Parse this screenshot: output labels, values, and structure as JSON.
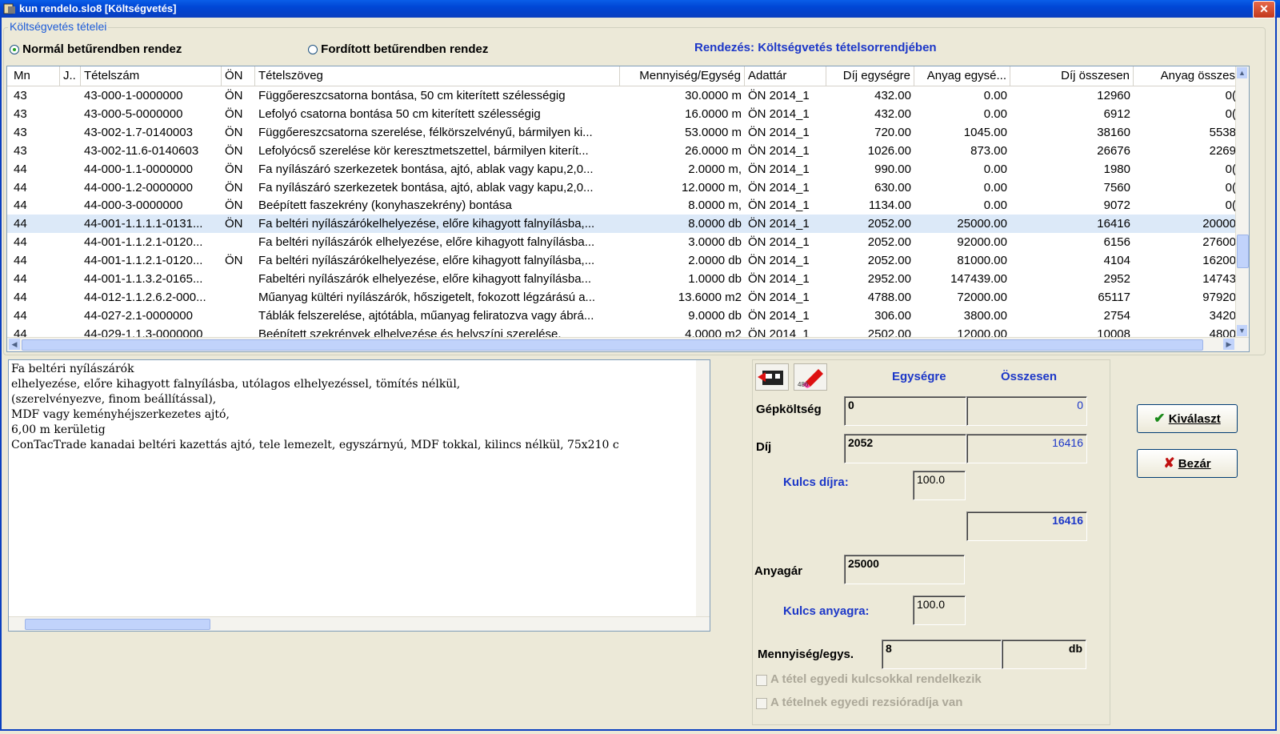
{
  "window": {
    "title": "kun rendelo.slo8 [Költségvetés]",
    "close": "✕"
  },
  "group_label": "Költségvetés tételei",
  "sort_options": [
    {
      "label": "Normál betűrendben rendez",
      "selected": true
    },
    {
      "label": "Fordított betűrendben rendez",
      "selected": false
    }
  ],
  "sort_status": "Rendezés: Költségvetés tételsorrendjében",
  "table": {
    "columns": [
      "Mn",
      "J..",
      "Tételszám",
      "ÖN",
      "Tételszöveg",
      "Mennyiség/Egység",
      "Adattár",
      "Díj egységre",
      "Anyag egysé...",
      "Díj összesen",
      "Anyag összes"
    ],
    "rows": [
      [
        "43",
        "",
        "43-000-1-0000000",
        "ÖN",
        "Függőereszcsatorna bontása, 50 cm kiterített szélességig",
        "30.0000 m",
        "ÖN 2014_1",
        "432.00",
        "0.00",
        "12960",
        "0("
      ],
      [
        "43",
        "",
        "43-000-5-0000000",
        "ÖN",
        "Lefolyó csatorna bontása 50 cm kiterített szélességig",
        "16.0000 m",
        "ÖN 2014_1",
        "432.00",
        "0.00",
        "6912",
        "0("
      ],
      [
        "43",
        "",
        "43-002-1.7-0140003",
        "ÖN",
        "Függőereszcsatorna szerelése, félkörszelvényű, bármilyen ki...",
        "53.0000 m",
        "ÖN 2014_1",
        "720.00",
        "1045.00",
        "38160",
        "5538"
      ],
      [
        "43",
        "",
        "43-002-11.6-0140603",
        "ÖN",
        "Lefolyócső szerelése kör keresztmetszettel, bármilyen kiterít...",
        "26.0000 m",
        "ÖN 2014_1",
        "1026.00",
        "873.00",
        "26676",
        "2269"
      ],
      [
        "44",
        "",
        "44-000-1.1-0000000",
        "ÖN",
        "Fa nyílászáró szerkezetek bontása,  ajtó, ablak vagy kapu,2,0...",
        "2.0000 m,",
        "ÖN 2014_1",
        "990.00",
        "0.00",
        "1980",
        "0("
      ],
      [
        "44",
        "",
        "44-000-1.2-0000000",
        "ÖN",
        "Fa nyílászáró szerkezetek bontása,  ajtó, ablak vagy kapu,2,0...",
        "12.0000 m,",
        "ÖN 2014_1",
        "630.00",
        "0.00",
        "7560",
        "0("
      ],
      [
        "44",
        "",
        "44-000-3-0000000",
        "ÖN",
        "Beépített faszekrény (konyhaszekrény) bontása",
        "8.0000 m,",
        "ÖN 2014_1",
        "1134.00",
        "0.00",
        "9072",
        "0("
      ],
      [
        "44",
        "",
        "44-001-1.1.1.1-0131...",
        "ÖN",
        "Fa beltéri nyílászárókelhelyezése, előre kihagyott falnyílásba,...",
        "8.0000 db",
        "ÖN 2014_1",
        "2052.00",
        "25000.00",
        "16416",
        "20000"
      ],
      [
        "44",
        "",
        "44-001-1.1.2.1-0120...",
        "",
        "Fa beltéri nyílászárók elhelyezése, előre kihagyott falnyílásba...",
        "3.0000 db",
        "ÖN 2014_1",
        "2052.00",
        "92000.00",
        "6156",
        "27600"
      ],
      [
        "44",
        "",
        "44-001-1.1.2.1-0120...",
        "ÖN",
        "Fa beltéri nyílászárókelhelyezése, előre kihagyott falnyílásba,...",
        "2.0000 db",
        "ÖN 2014_1",
        "2052.00",
        "81000.00",
        "4104",
        "16200"
      ],
      [
        "44",
        "",
        "44-001-1.1.3.2-0165...",
        "",
        "Fabeltéri nyílászárók elhelyezése, előre kihagyott falnyílásba...",
        "1.0000 db",
        "ÖN 2014_1",
        "2952.00",
        "147439.00",
        "2952",
        "14743"
      ],
      [
        "44",
        "",
        "44-012-1.1.2.6.2-000...",
        "",
        "Műanyag kültéri nyílászárók, hőszigetelt, fokozott légzárású a...",
        "13.6000 m2",
        "ÖN 2014_1",
        "4788.00",
        "72000.00",
        "65117",
        "97920"
      ],
      [
        "44",
        "",
        "44-027-2.1-0000000",
        "",
        "Táblák felszerelése, ajtótábla, műanyag feliratozva vagy ábrá...",
        "9.0000 db",
        "ÖN 2014_1",
        "306.00",
        "3800.00",
        "2754",
        "3420"
      ],
      [
        "44",
        "",
        "44-029-1.1.3-0000000",
        "",
        "Beépített szekrények elhelyezése és helyszíni szerelése,",
        "4.0000 m2",
        "ÖN 2014_1",
        "2502.00",
        "12000.00",
        "10008",
        "4800"
      ]
    ],
    "selected_row": 7
  },
  "description_lines": [
    "Fa beltéri nyílászárók",
    "elhelyezése, előre kihagyott falnyílásba, utólagos elhelyezéssel, tömítés nélkül,",
    "(szerelvényezve, finom beállítással),",
    "MDF vagy keményhéjszerkezetes ajtó,",
    "6,00 m kerületig",
    "ConTacTrade kanadai beltéri kazettás ajtó, tele lemezelt, egyszárnyú, MDF tokkal, kilincs nélkül, 75x210 c"
  ],
  "panel": {
    "col_unit": "Egységre",
    "col_total": "Összesen",
    "gep_label": "Gépköltség",
    "gep_unit": "0",
    "gep_total": "0",
    "dij_label": "Díj",
    "dij_unit": "2052",
    "dij_total": "16416",
    "kulcs_dij_label": "Kulcs díjra:",
    "kulcs_dij": "100.0",
    "dij_total2": "16416",
    "anyag_label": "Anyagár",
    "anyag_unit": "25000",
    "kulcs_anyag_label": "Kulcs anyagra:",
    "kulcs_anyag": "100.0",
    "menny_label": "Mennyiség/egys.",
    "menny_value": "8",
    "menny_unit": "db",
    "chk1": "A tétel egyedi kulcsokkal rendelkezik",
    "chk2": "A tételnek egyedi rezsióradíja van"
  },
  "buttons": {
    "select": "Kiválaszt",
    "close": "Bezár"
  }
}
